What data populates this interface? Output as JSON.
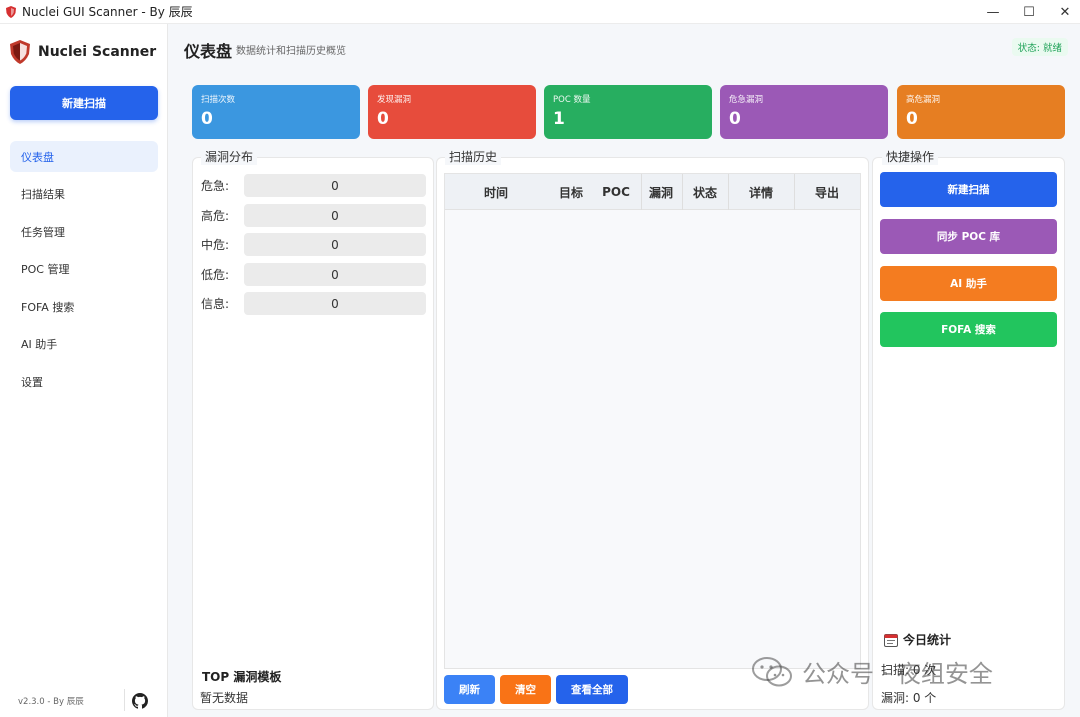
{
  "window": {
    "title": "Nuclei GUI Scanner - By 辰辰",
    "minimize": "—",
    "maximize": "☐",
    "close": "✕"
  },
  "sidebar": {
    "brand": "Nuclei Scanner",
    "new_scan": "新建扫描",
    "items": [
      {
        "label": "仪表盘",
        "active": true
      },
      {
        "label": "扫描结果"
      },
      {
        "label": "任务管理"
      },
      {
        "label": "POC 管理"
      },
      {
        "label": "FOFA 搜索"
      },
      {
        "label": "AI 助手"
      },
      {
        "label": "设置"
      }
    ],
    "version": "v2.3.0 - By 辰辰"
  },
  "header": {
    "title": "仪表盘",
    "subtitle": "数据统计和扫描历史概览",
    "status": "状态: 就绪"
  },
  "stats": [
    {
      "label": "扫描次数",
      "value": "0",
      "color": "#3b97e0"
    },
    {
      "label": "发现漏洞",
      "value": "0",
      "color": "#e74c3c"
    },
    {
      "label": "POC 数量",
      "value": "1",
      "color": "#27ae60"
    },
    {
      "label": "危急漏洞",
      "value": "0",
      "color": "#9b59b6"
    },
    {
      "label": "高危漏洞",
      "value": "0",
      "color": "#e67e22"
    }
  ],
  "distribution": {
    "title": "漏洞分布",
    "rows": [
      {
        "label": "危急:",
        "value": "0"
      },
      {
        "label": "高危:",
        "value": "0"
      },
      {
        "label": "中危:",
        "value": "0"
      },
      {
        "label": "低危:",
        "value": "0"
      },
      {
        "label": "信息:",
        "value": "0"
      }
    ],
    "top_title": "TOP 漏洞模板",
    "top_empty": "暂无数据"
  },
  "history": {
    "title": "扫描历史",
    "columns": [
      "时间",
      "目标",
      "POC",
      "漏洞",
      "状态",
      "详情",
      "导出"
    ],
    "rows": [],
    "buttons": {
      "refresh": "刷新",
      "clear": "清空",
      "view_all": "查看全部"
    }
  },
  "quick": {
    "title": "快捷操作",
    "buttons": [
      {
        "label": "新建扫描",
        "color": "#2563eb"
      },
      {
        "label": "同步 POC 库",
        "color": "#9b59b6"
      },
      {
        "label": "AI 助手",
        "color": "#f47c20"
      },
      {
        "label": "FOFA 搜索",
        "color": "#22c55e"
      }
    ],
    "today_title": "今日统计",
    "today_scans": "扫描: 0 次",
    "today_vulns": "漏洞: 0 个"
  },
  "watermark": "公众号 · 夜组安全"
}
